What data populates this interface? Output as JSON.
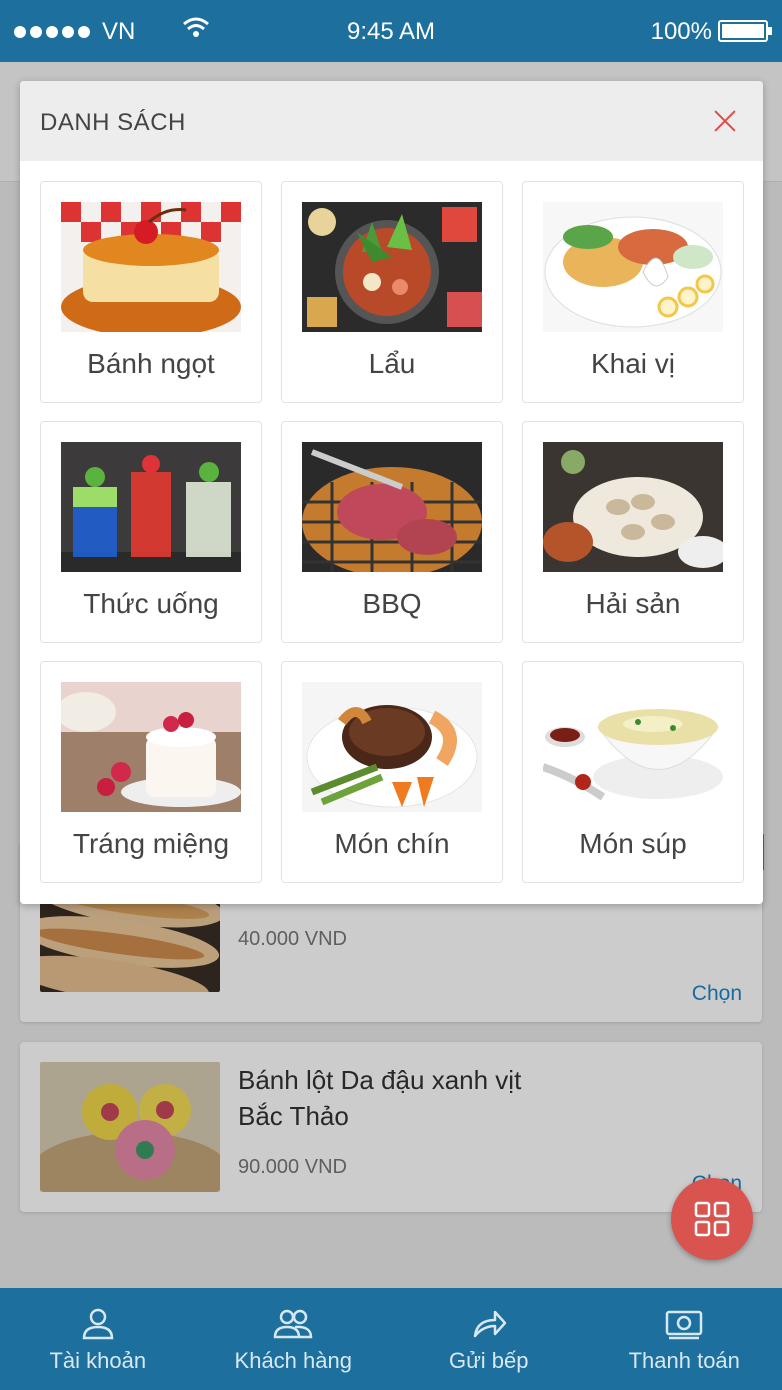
{
  "status_bar": {
    "carrier": "VN",
    "time": "9:45 AM",
    "battery": "100%"
  },
  "modal": {
    "title": "DANH SÁCH",
    "categories": [
      {
        "label": "Bánh ngọt",
        "icon": "flan-photo"
      },
      {
        "label": "Lẩu",
        "icon": "hotpot-photo"
      },
      {
        "label": "Khai vị",
        "icon": "appetizer-platter-photo"
      },
      {
        "label": "Thức uống",
        "icon": "drinks-photo"
      },
      {
        "label": "BBQ",
        "icon": "bbq-grill-photo"
      },
      {
        "label": "Hải sản",
        "icon": "seafood-photo"
      },
      {
        "label": "Tráng miệng",
        "icon": "dessert-photo"
      },
      {
        "label": "Món chín",
        "icon": "steak-photo"
      },
      {
        "label": "Món súp",
        "icon": "soup-photo"
      }
    ]
  },
  "products": [
    {
      "name": "",
      "price": "40.000 VND",
      "action": "Chọn"
    },
    {
      "name": "Bánh lột Da đậu xanh vịt Bắc Thảo",
      "price": "90.000 VND",
      "action": "Chọn"
    }
  ],
  "tabbar": {
    "items": [
      {
        "label": "Tài khoản",
        "icon": "user-icon"
      },
      {
        "label": "Khách hàng",
        "icon": "users-icon"
      },
      {
        "label": "Gửi bếp",
        "icon": "share-arrow-icon"
      },
      {
        "label": "Thanh toán",
        "icon": "cash-icon"
      }
    ]
  },
  "colors": {
    "primary": "#1d6f9d",
    "accent": "#d9534f",
    "link": "#1d86c8"
  }
}
